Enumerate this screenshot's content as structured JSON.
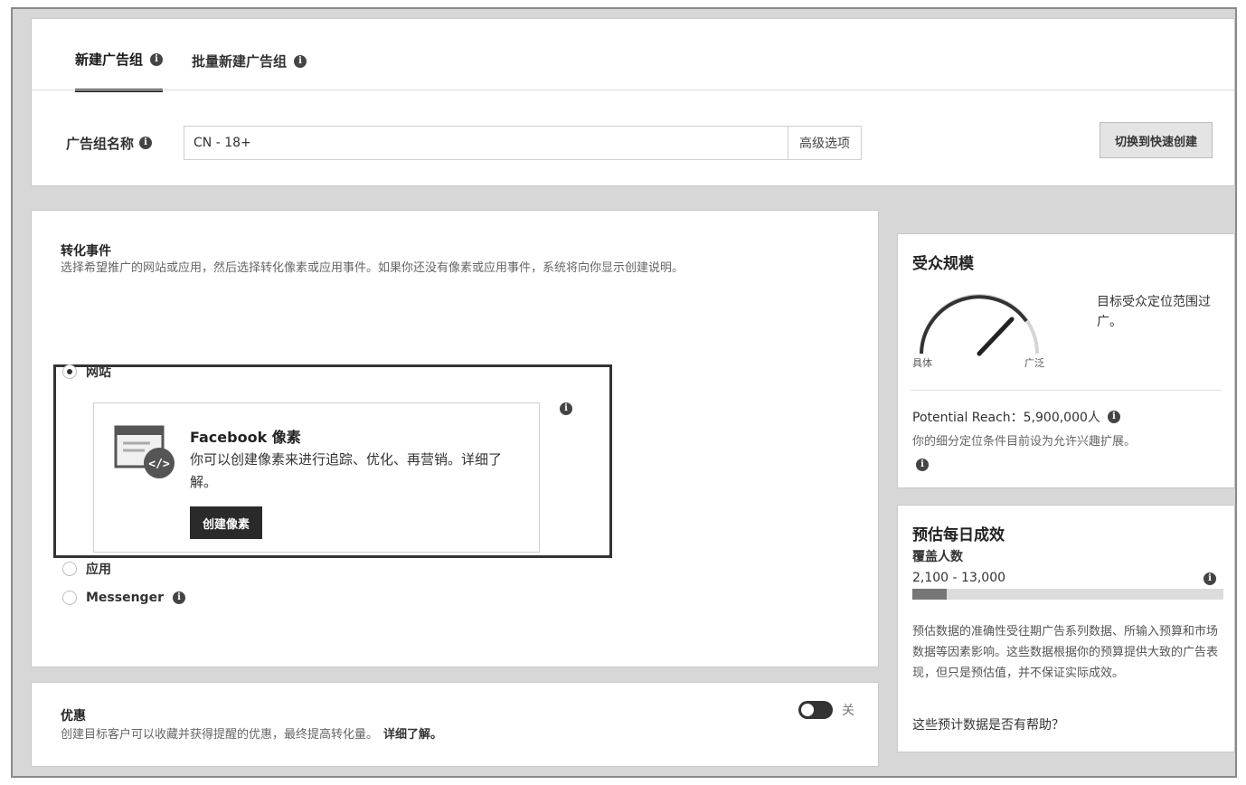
{
  "tabs": [
    {
      "label": "新建广告组"
    },
    {
      "label": "批量新建广告组"
    }
  ],
  "adset": {
    "name_label": "广告组名称",
    "name_value": "CN - 18+",
    "advanced_label": "高级选项",
    "switch_label": "切换到快速创建"
  },
  "conversion": {
    "title": "转化事件",
    "description": "选择希望推广的网站或应用，然后选择转化像素或应用事件。如果你还没有像素或应用事件，系统将向你显示创建说明。",
    "options": [
      {
        "label": "网站",
        "checked": true
      },
      {
        "label": "应用",
        "checked": false
      },
      {
        "label": "Messenger",
        "checked": false
      }
    ],
    "pixel": {
      "title": "Facebook 像素",
      "description": "你可以创建像素来进行追踪、优化、再营销。详细了解。",
      "button_label": "创建像素",
      "icon": "pixel-code-icon"
    }
  },
  "offers": {
    "title": "优惠",
    "description": "创建目标客户可以收藏并获得提醒的优惠，最终提高转化量。",
    "learn_more": "详细了解。",
    "toggle_label": "关",
    "toggle_on": false
  },
  "audience": {
    "title": "受众规模",
    "gauge_low": "具体",
    "gauge_high": "广泛",
    "note": "目标受众定位范围过广。",
    "reach": "Potential Reach：5,900,000人",
    "reach_note": "你的细分定位条件目前设为允许兴趣扩展。"
  },
  "estimate": {
    "title": "预估每日成效",
    "subtitle": "覆盖人数",
    "range": "2,100 - 13,000",
    "bar_fraction": 0.11,
    "note": "预估数据的准确性受往期广告系列数据、所输入预算和市场数据等因素影响。这些数据根据你的预算提供大致的广告表现，但只是预估值，并不保证实际成效。",
    "help": "这些预计数据是否有帮助？"
  },
  "colors": {
    "frame": "#d7d7d7",
    "button_dark": "#2a2a2a",
    "text": "#222222"
  }
}
